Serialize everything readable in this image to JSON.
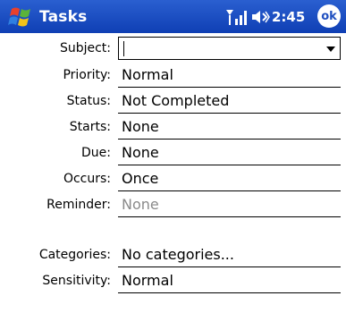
{
  "titlebar": {
    "app_title": "Tasks",
    "time": "2:45",
    "ok_label": "ok",
    "bg_color": "#1f4fc0"
  },
  "form": {
    "subject": {
      "label": "Subject:",
      "value": ""
    },
    "priority": {
      "label": "Priority:",
      "value": "Normal"
    },
    "status": {
      "label": "Status:",
      "value": "Not Completed"
    },
    "starts": {
      "label": "Starts:",
      "value": "None"
    },
    "due": {
      "label": "Due:",
      "value": "None"
    },
    "occurs": {
      "label": "Occurs:",
      "value": "Once"
    },
    "reminder": {
      "label": "Reminder:",
      "value": "None"
    },
    "categories": {
      "label": "Categories:",
      "value": "No categories..."
    },
    "sensitivity": {
      "label": "Sensitivity:",
      "value": "Normal"
    }
  },
  "icons": {
    "start": "windows-flag-icon",
    "signal": "signal-strength-icon",
    "volume": "speaker-volume-icon"
  }
}
